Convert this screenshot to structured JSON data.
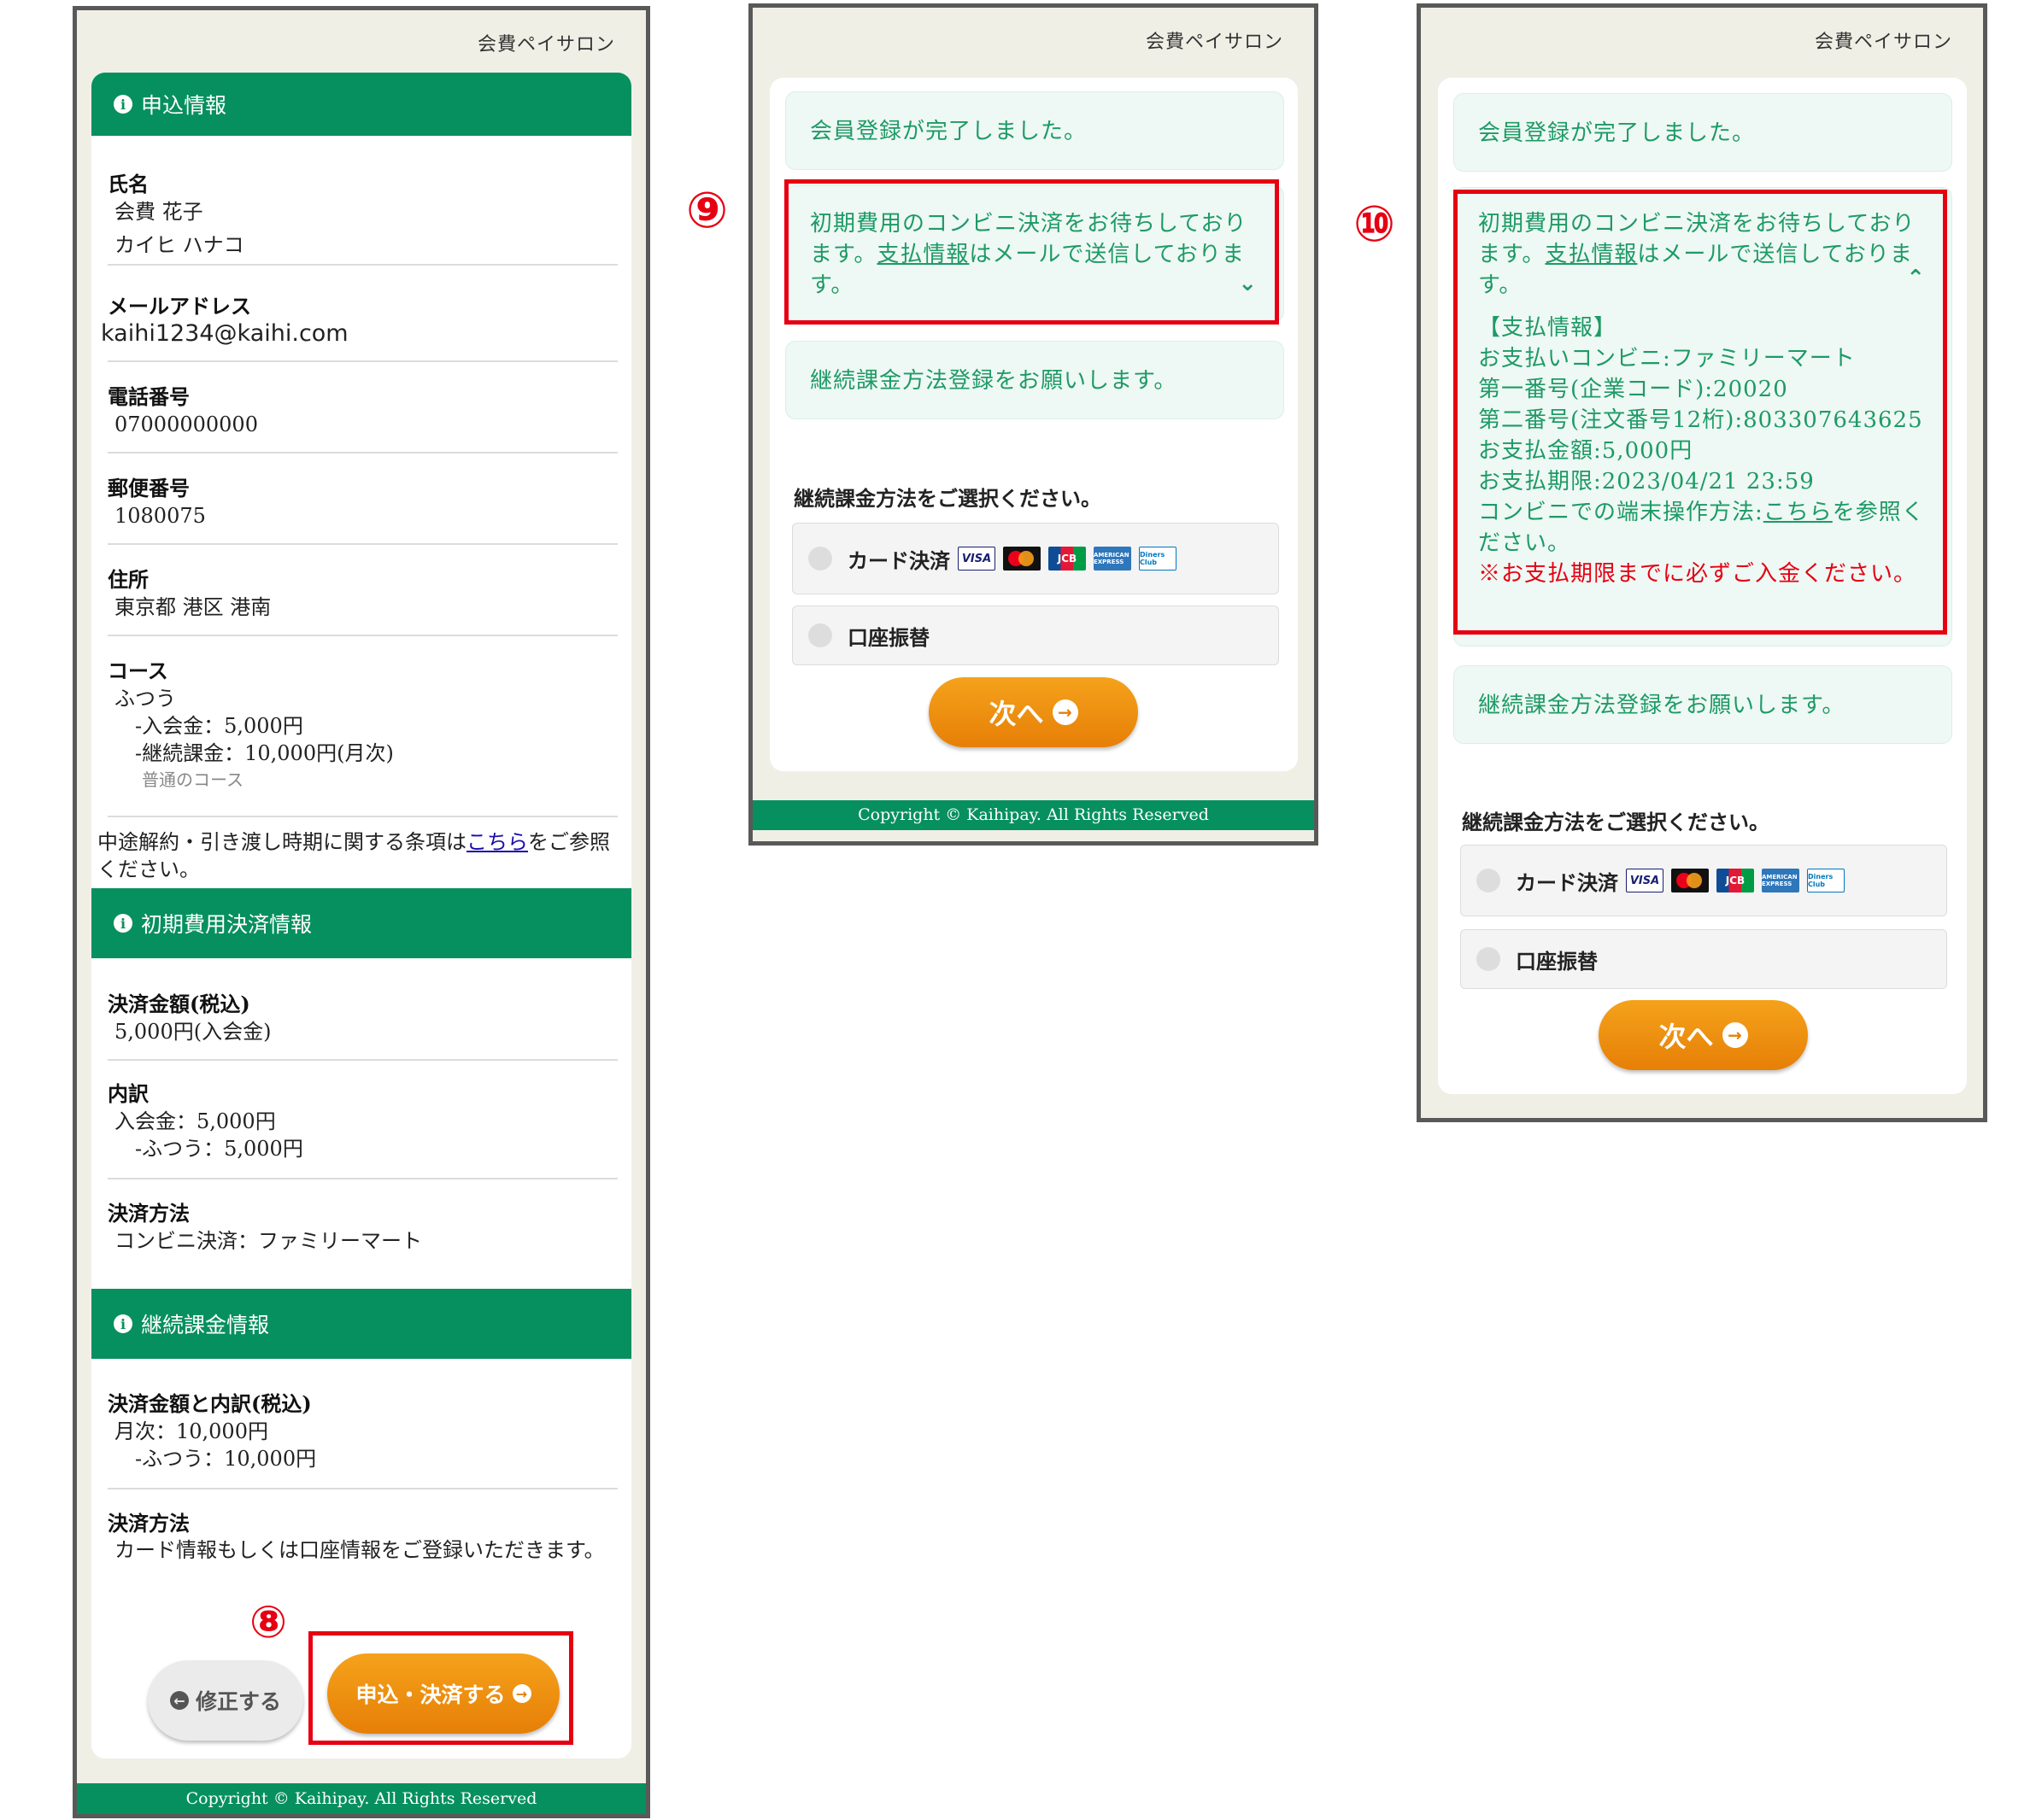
{
  "brand": "会費ペイサロン",
  "footer": "Copyright © Kaihipay. All Rights Reserved",
  "screen1": {
    "sections": {
      "application": "申込情報",
      "initial_payment": "初期費用決済情報",
      "recurring": "継続課金情報"
    },
    "name": {
      "label": "氏名",
      "value": "会費 花子",
      "kana": "カイヒ ハナコ"
    },
    "email": {
      "label": "メールアドレス",
      "value": "kaihi1234@kaihi.com"
    },
    "phone": {
      "label": "電話番号",
      "value": "07000000000"
    },
    "postal": {
      "label": "郵便番号",
      "value": "1080075"
    },
    "address": {
      "label": "住所",
      "value": "東京都 港区 港南"
    },
    "course": {
      "label": "コース",
      "value": "ふつう",
      "entry_fee": "-入会金：5,000円",
      "recurring_fee": "-継続課金：10,000円(月次)",
      "note": "普通のコース"
    },
    "terms": {
      "before": "中途解約・引き渡し時期に関する条項は",
      "link": "こちら",
      "after": "をご参照ください。"
    },
    "amount": {
      "label": "決済金額(税込)",
      "value": "5,000円(入会金)"
    },
    "breakdown": {
      "label": "内訳",
      "line1": "入会金：5,000円",
      "line2": "-ふつう：5,000円"
    },
    "method": {
      "label": "決済方法",
      "value": "コンビニ決済：ファミリーマート"
    },
    "recurring_amount": {
      "label": "決済金額と内訳(税込)",
      "line1": "月次：10,000円",
      "line2": "-ふつう：10,000円"
    },
    "recurring_method": {
      "label": "決済方法",
      "value": "カード情報もしくは口座情報をご登録いただきます。"
    },
    "edit_button": "修正する",
    "submit_button": "申込・決済する",
    "marker": "⑧"
  },
  "screen2": {
    "marker": "⑨",
    "complete": "会員登録が完了しました。",
    "waiting": {
      "before": "初期費用のコンビニ決済をお待ちしております。",
      "link": "支払情報",
      "after": "はメールで送信しております。"
    },
    "request": "継続課金方法登録をお願いします。",
    "choose": "継続課金方法をご選択ください。",
    "option_card": "カード決済",
    "option_bank": "口座振替",
    "next_button": "次へ"
  },
  "screen3": {
    "marker": "⑩",
    "complete": "会員登録が完了しました。",
    "waiting": {
      "before": "初期費用のコンビニ決済をお待ちしております。",
      "link": "支払情報",
      "after": "はメールで送信しております。"
    },
    "details": {
      "heading": "【支払情報】",
      "store": "お支払いコンビニ:ファミリーマート",
      "code1": "第一番号(企業コード):20020",
      "code2": "第二番号(注文番号12桁):803307643625",
      "amount": "お支払金額:5,000円",
      "deadline": "お支払期限:2023/04/21 23:59",
      "howto_before": "コンビニでの端末操作方法:",
      "howto_link": "こちら",
      "howto_after": "を参照ください。",
      "warning": "※お支払期限までに必ずご入金ください。"
    },
    "request": "継続課金方法登録をお願いします。",
    "choose": "継続課金方法をご選択ください。",
    "option_card": "カード決済",
    "option_bank": "口座振替",
    "next_button": "次へ"
  },
  "card_brands": [
    "VISA",
    "Mastercard",
    "JCB",
    "AMERICAN EXPRESS",
    "Diners Club"
  ],
  "colors": {
    "brand_green": "#06905f",
    "notice_text": "#1e9a66",
    "accent_orange": "#f08c10",
    "highlight_red": "#e60012"
  }
}
